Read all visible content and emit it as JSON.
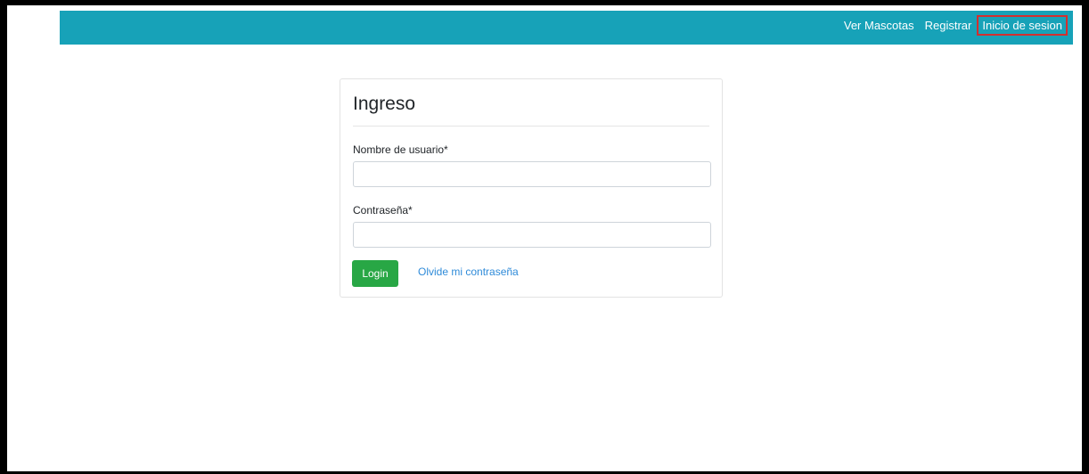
{
  "navbar": {
    "links": [
      {
        "label": "Ver Mascotas"
      },
      {
        "label": "Registrar"
      },
      {
        "label": "Inicio de sesion"
      }
    ]
  },
  "login_card": {
    "title": "Ingreso",
    "username_label": "Nombre de usuario*",
    "username_value": "",
    "password_label": "Contraseña*",
    "password_value": "",
    "login_button": "Login",
    "forgot_link": "Olvide mi contraseña"
  },
  "colors": {
    "navbar": "#17a2b8",
    "login_button": "#28a745",
    "link": "#2f8bd9",
    "highlight": "#d32f2f"
  }
}
